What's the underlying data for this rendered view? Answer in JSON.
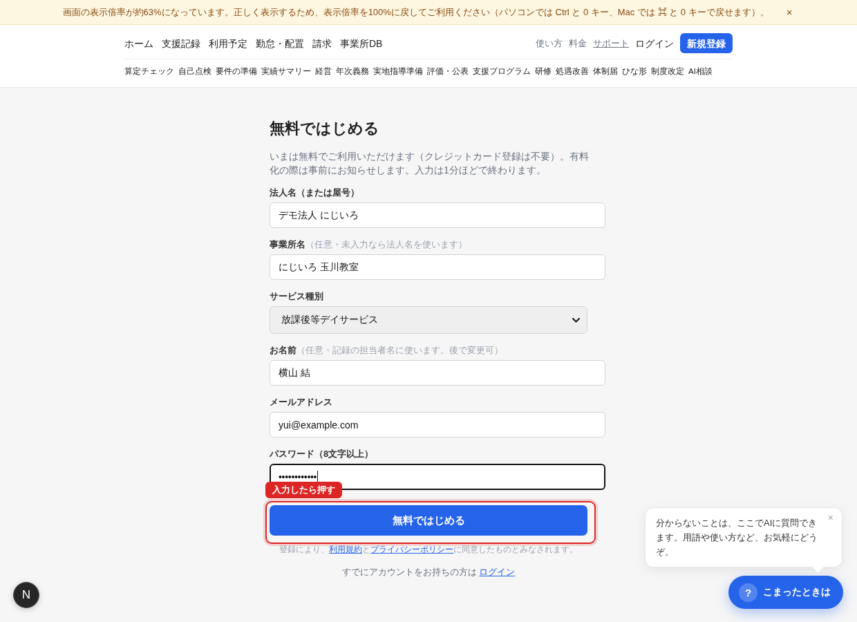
{
  "banner": {
    "message": "画面の表示倍率が約63%になっています。正しく表示するため、表示倍率を100%に戻してご利用ください（パソコンでは Ctrl と 0 キー、Mac では ⌘ と 0 キーで戻せます）。",
    "close": "×"
  },
  "header": {
    "nav": [
      "ホーム",
      "支援記録",
      "利用予定",
      "勤怠・配置",
      "請求",
      "事業所DB"
    ],
    "links": [
      {
        "label": "使い方",
        "kind": "muted"
      },
      {
        "label": "料金",
        "kind": "muted"
      },
      {
        "label": "サポート",
        "kind": "underlined"
      },
      {
        "label": "ログイン",
        "kind": "strong"
      }
    ],
    "signup_button": "新規登録",
    "subnav": [
      "算定チェック",
      "自己点検",
      "要件の準備",
      "実績サマリー",
      "経営",
      "年次義務",
      "実地指導準備",
      "評価・公表",
      "支援プログラム",
      "研修",
      "処遇改善",
      "体制届",
      "ひな形",
      "制度改定",
      "AI相談"
    ]
  },
  "form": {
    "title": "無料ではじめる",
    "description": "いまは無料でご利用いただけます（クレジットカード登録は不要）。有料化の際は事前にお知らせします。入力は1分ほどで終わります。",
    "fields": [
      {
        "kind": "text",
        "label": "法人名（または屋号）",
        "value": "デモ法人 にじいろ",
        "focused": false
      },
      {
        "kind": "text",
        "label": "事業所名",
        "hint": "（任意・未入力なら法人名を使います）",
        "value": "にじいろ 玉川教室",
        "focused": false
      },
      {
        "kind": "select",
        "label": "サービス種別",
        "value": "放課後等デイサービス",
        "focused": false
      },
      {
        "kind": "text",
        "label": "お名前",
        "hint": "（任意・記録の担当者名に使います。後で変更可）",
        "value": "横山 結",
        "focused": false
      },
      {
        "kind": "text",
        "label": "メールアドレス",
        "value": "yui@example.com",
        "focused": false
      },
      {
        "kind": "password",
        "label": "パスワード（8文字以上）",
        "value": "••••••••••••",
        "focused": true
      }
    ],
    "callout": "入力したら押す",
    "submit": {
      "label": "無料ではじめる",
      "highlighted": true
    },
    "terms": [
      {
        "kind": "text",
        "text": "登録により、"
      },
      {
        "kind": "link",
        "text": "利用規約"
      },
      {
        "kind": "text",
        "text": "と"
      },
      {
        "kind": "link",
        "text": "プライバシーポリシー"
      },
      {
        "kind": "text",
        "text": "に同意したものとみなされます。"
      }
    ],
    "login_prompt": [
      {
        "kind": "text",
        "text": "すでにアカウントをお持ちの方は "
      },
      {
        "kind": "link",
        "text": "ログイン"
      }
    ]
  },
  "help": {
    "bubble": {
      "text": "分からないことは、ここでAIに質問できます。用語や使い方など、お気軽にどうぞ。",
      "close": "×"
    },
    "button": {
      "icon": "?",
      "label": "こまったときは"
    }
  },
  "dev_indicator": "N"
}
